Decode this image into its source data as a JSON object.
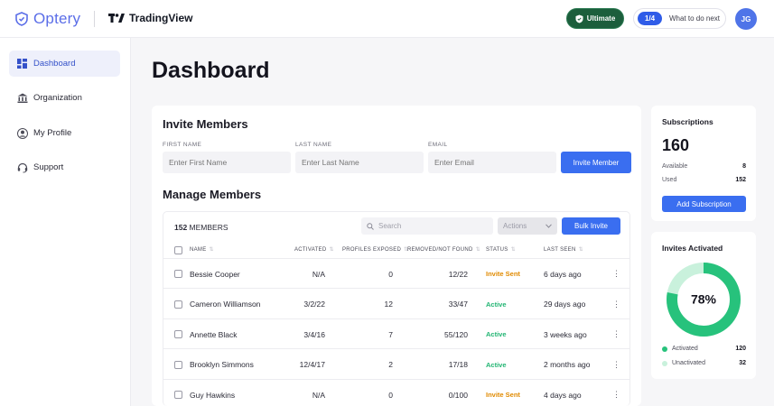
{
  "header": {
    "brand": "Optery",
    "partner": "TradingView",
    "plan_badge": "Ultimate",
    "todo_progress": "1/4",
    "todo_label": "What to do next",
    "avatar_initials": "JG"
  },
  "sidebar": {
    "items": [
      {
        "label": "Dashboard",
        "icon": "grid-icon",
        "active": true
      },
      {
        "label": "Organization",
        "icon": "building-icon"
      },
      {
        "label": "My Profile",
        "icon": "user-icon"
      },
      {
        "label": "Support",
        "icon": "headset-icon"
      }
    ]
  },
  "page": {
    "title": "Dashboard"
  },
  "invite": {
    "title": "Invite Members",
    "first_name_label": "FIRST NAME",
    "first_name_placeholder": "Enter First Name",
    "last_name_label": "LAST NAME",
    "last_name_placeholder": "Enter Last Name",
    "email_label": "EMAIL",
    "email_placeholder": "Enter Email",
    "button": "Invite Member"
  },
  "manage": {
    "title": "Manage Members",
    "count": "152",
    "count_label": " MEMBERS",
    "search_placeholder": "Search",
    "actions_label": "Actions",
    "bulk_button": "Bulk Invite",
    "columns": {
      "name": "NAME",
      "activated": "ACTIVATED",
      "profiles_exposed": "PROFILES EXPOSED",
      "removed": "REMOVED/NOT FOUND",
      "status": "STATUS",
      "last_seen": "LAST SEEN"
    },
    "rows": [
      {
        "name": "Bessie Cooper",
        "activated": "N/A",
        "exposed": "0",
        "removed": "12/22",
        "status": "Invite Sent",
        "last_seen": "6 days ago"
      },
      {
        "name": "Cameron Williamson",
        "activated": "3/2/22",
        "exposed": "12",
        "removed": "33/47",
        "status": "Active",
        "last_seen": "29 days ago"
      },
      {
        "name": "Annette Black",
        "activated": "3/4/16",
        "exposed": "7",
        "removed": "55/120",
        "status": "Active",
        "last_seen": "3 weeks ago"
      },
      {
        "name": "Brooklyn Simmons",
        "activated": "12/4/17",
        "exposed": "2",
        "removed": "17/18",
        "status": "Active",
        "last_seen": "2 months ago"
      },
      {
        "name": "Guy Hawkins",
        "activated": "N/A",
        "exposed": "0",
        "removed": "0/100",
        "status": "Invite Sent",
        "last_seen": "4 days ago"
      }
    ]
  },
  "subscriptions": {
    "title": "Subscriptions",
    "total": "160",
    "available_label": "Available",
    "available": "8",
    "used_label": "Used",
    "used": "152",
    "button": "Add Subscription"
  },
  "invites_activated": {
    "title": "Invites Activated",
    "percent_label": "78%",
    "percent": 78,
    "activated_label": "Activated",
    "activated": "120",
    "unactivated_label": "Unactivated",
    "unactivated": "32"
  },
  "colors": {
    "accent": "#3a6ef0",
    "active_status": "#22b573",
    "invite_status": "#e08a00",
    "donut_main": "#27c27c",
    "donut_rest": "#c9f1dc"
  }
}
